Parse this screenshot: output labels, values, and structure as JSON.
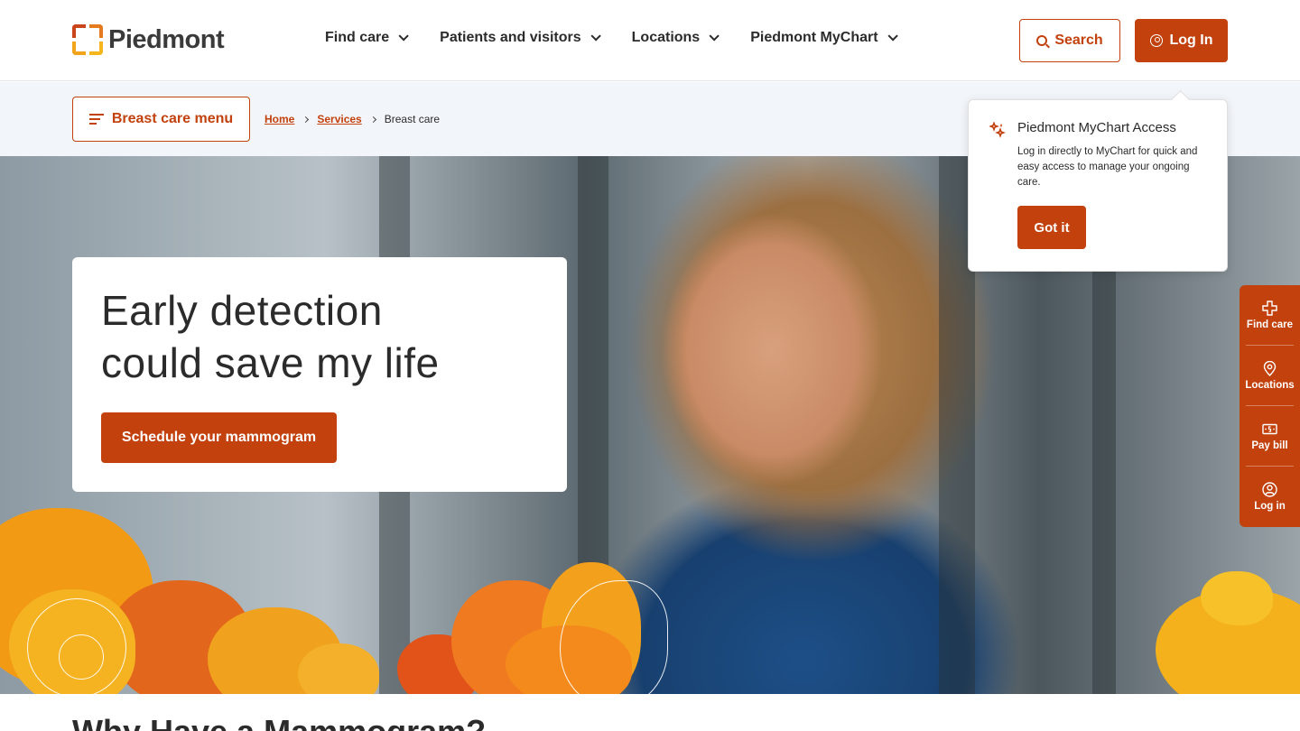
{
  "header": {
    "logo_text": "Piedmont",
    "nav": [
      {
        "label": "Find care"
      },
      {
        "label": "Patients and visitors"
      },
      {
        "label": "Locations"
      },
      {
        "label": "Piedmont MyChart"
      }
    ],
    "search_label": "Search",
    "login_label": "Log In"
  },
  "subbar": {
    "menu_label": "Breast care menu",
    "breadcrumb": {
      "home": "Home",
      "services": "Services",
      "current": "Breast care"
    }
  },
  "hero": {
    "title_line1": "Early detection",
    "title_line2": "could save my life",
    "cta_label": "Schedule your mammogram"
  },
  "popover": {
    "title": "Piedmont MyChart Access",
    "text": "Log in directly to MyChart for quick and easy access to manage your ongoing care.",
    "button_label": "Got it"
  },
  "side_rail": [
    {
      "label": "Find care",
      "icon": "plus-icon"
    },
    {
      "label": "Locations",
      "icon": "map-pin-icon"
    },
    {
      "label": "Pay bill",
      "icon": "bill-icon"
    },
    {
      "label": "Log in",
      "icon": "user-icon"
    }
  ],
  "section_heading": "Why Have a Mammogram?",
  "colors": {
    "accent": "#c2410c",
    "subbar_bg": "#f2f5fa"
  }
}
